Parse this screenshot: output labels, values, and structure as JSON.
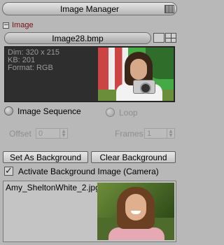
{
  "window": {
    "title": "Image Manager",
    "menu_icon": "panel-menu-icon"
  },
  "image_section": {
    "collapse_icon": "minus-icon",
    "title": "Image",
    "filename": "Image28.bmp",
    "info": {
      "dimensions": "Dim: 320 x 215",
      "size": "KB: 201",
      "format": "Format: RGB"
    }
  },
  "options": {
    "image_sequence_label": "Image Sequence",
    "loop_label": "Loop",
    "offset_label": "Offset",
    "offset_value": "0",
    "frames_label": "Frames",
    "frames_value": "1"
  },
  "buttons": {
    "set_background": "Set As Background",
    "clear_background": "Clear Background"
  },
  "background": {
    "activate_label": "Activate Background Image (Camera)",
    "activate_checked": true,
    "filename": "Amy_SheltonWhite_2.jpg"
  },
  "colors": {
    "section_title": "#7a1010",
    "info_panel": "#2e2e2e",
    "panel_bg": "#b8b8b8"
  }
}
